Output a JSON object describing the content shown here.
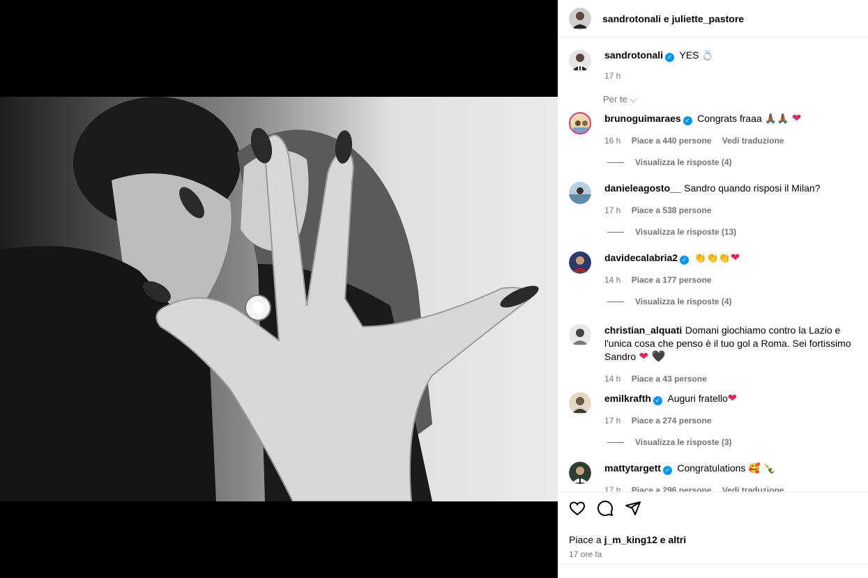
{
  "header": {
    "title": "sandrotonali e juliette_pastore"
  },
  "caption": {
    "user": "sandrotonali",
    "text": "YES 💍",
    "time": "17 h"
  },
  "sort": {
    "label": "Per te"
  },
  "comments": [
    {
      "user": "brunoguimaraes",
      "verified": true,
      "text": "Congrats fraaa 🙏🏾🙏🏾",
      "heart": "❤",
      "time": "16 h",
      "likes": "Piace a 440 persone",
      "translate": "Vedi traduzione",
      "replies": "Visualizza le risposte (4)"
    },
    {
      "user": "danieleagosto__",
      "verified": false,
      "text": "Sandro quando risposi il Milan?",
      "heart": "",
      "time": "17 h",
      "likes": "Piace a 538 persone",
      "translate": "",
      "replies": "Visualizza le risposte (13)"
    },
    {
      "user": "davidecalabria2",
      "verified": true,
      "text": "👏👏👏",
      "heart": "❤",
      "time": "14 h",
      "likes": "Piace a 177 persone",
      "translate": "",
      "replies": "Visualizza le risposte (4)"
    },
    {
      "user": "christian_alquati",
      "verified": false,
      "text": "Domani giochiamo contro la Lazio e l'unica cosa che penso è il tuo gol a Roma. Sei fortissimo Sandro",
      "heart": "❤",
      "heart2": "🖤",
      "time": "14 h",
      "likes": "Piace a 43 persone",
      "translate": "",
      "replies": ""
    },
    {
      "user": "emilkrafth",
      "verified": true,
      "text": "Auguri fratello",
      "heart": "❤",
      "time": "17 h",
      "likes": "Piace a 274 persone",
      "translate": "",
      "replies": "Visualizza le risposte (3)"
    },
    {
      "user": "mattytargett",
      "verified": true,
      "text": "Congratulations 🥰 🍾",
      "heart": "",
      "time": "17 h",
      "likes": "Piace a 296 persone",
      "translate": "Vedi traduzione",
      "replies": ""
    }
  ],
  "footer": {
    "likes_prefix": "Piace a",
    "likes_user": "j_m_king12",
    "likes_suffix": "e altri",
    "ago": "17 ore fa"
  },
  "icons": [
    "heart-icon",
    "comment-icon",
    "share-icon"
  ],
  "colors": {
    "verified": "#0095f6",
    "muted": "#737373",
    "heart": "#e0245e"
  }
}
